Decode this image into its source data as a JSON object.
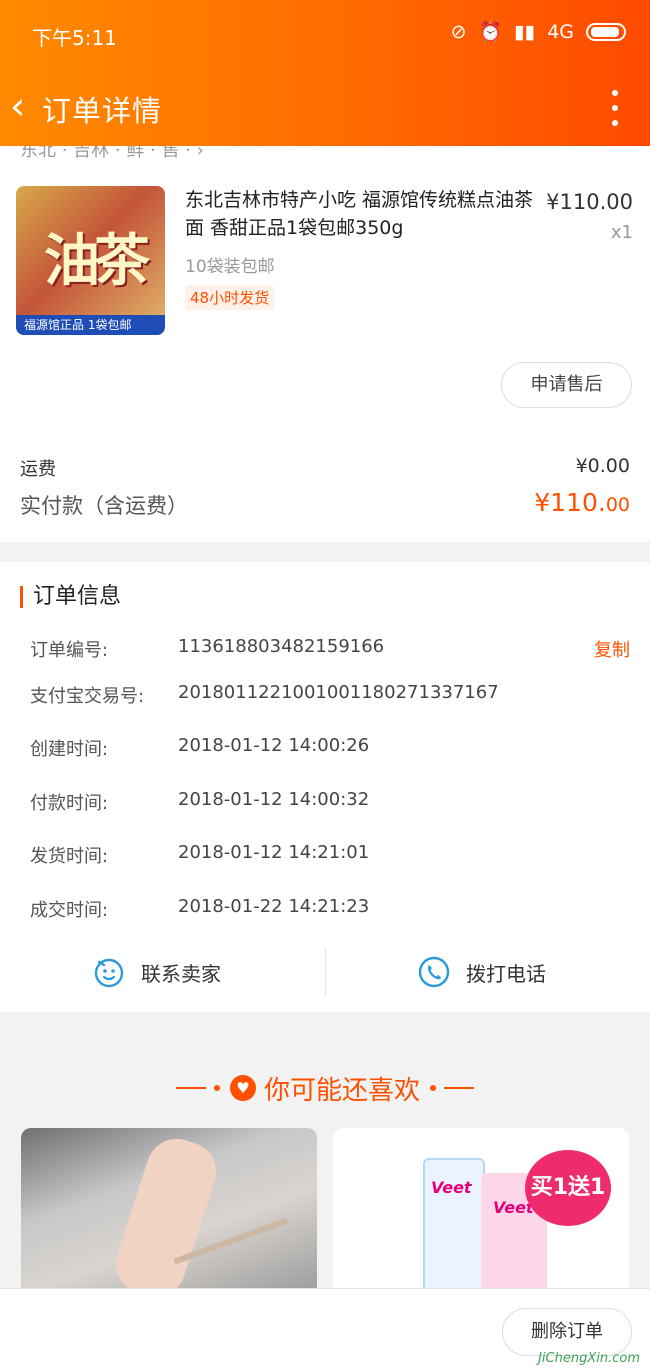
{
  "status": {
    "time": "下午5:11",
    "network": "4G"
  },
  "navbar": {
    "back_icon": "‹",
    "title": "订单详情"
  },
  "product": {
    "partial_text": "东北 · 吉林 · 鲜 · 售 · ›",
    "thumb_text": "油茶",
    "thumb_band": "福源馆正品  1袋包邮",
    "title": "东北吉林市特产小吃 福源馆传统糕点油茶面 香甜正品1袋包邮350g",
    "price": "¥110.00",
    "quantity": "x1",
    "sku": "10袋装包邮",
    "tag": "48小时发货",
    "after_sale_button": "申请售后",
    "shipping_label": "运费",
    "shipping_value": "¥0.00",
    "paid_label": "实付款（含运费）",
    "paid_value_major": "¥110.",
    "paid_value_minor": "00"
  },
  "order_info": {
    "heading": "订单信息",
    "copy_label": "复制",
    "rows": [
      {
        "key": "订单编号:",
        "value": "113618803482159166"
      },
      {
        "key": "支付宝交易号:",
        "value": "2018011221001001180271337167"
      },
      {
        "key": "创建时间:",
        "value": "2018-01-12 14:00:26"
      },
      {
        "key": "付款时间:",
        "value": "2018-01-12 14:00:32"
      },
      {
        "key": "发货时间:",
        "value": "2018-01-12 14:21:01"
      },
      {
        "key": "成交时间:",
        "value": "2018-01-22 14:21:23"
      }
    ],
    "contact_seller": "联系卖家",
    "call_phone": "拨打电话"
  },
  "recommend": {
    "heading": "你可能还喜欢",
    "item2_brand": "Veet",
    "item2_badge": "买1送1"
  },
  "bottom": {
    "delete_button": "删除订单",
    "watermark": "JiChengXin.com"
  },
  "colors": {
    "accent": "#ff5000",
    "header_start": "#ff8a00",
    "header_end": "#ff4a00",
    "icon_blue": "#2a9ad8"
  }
}
